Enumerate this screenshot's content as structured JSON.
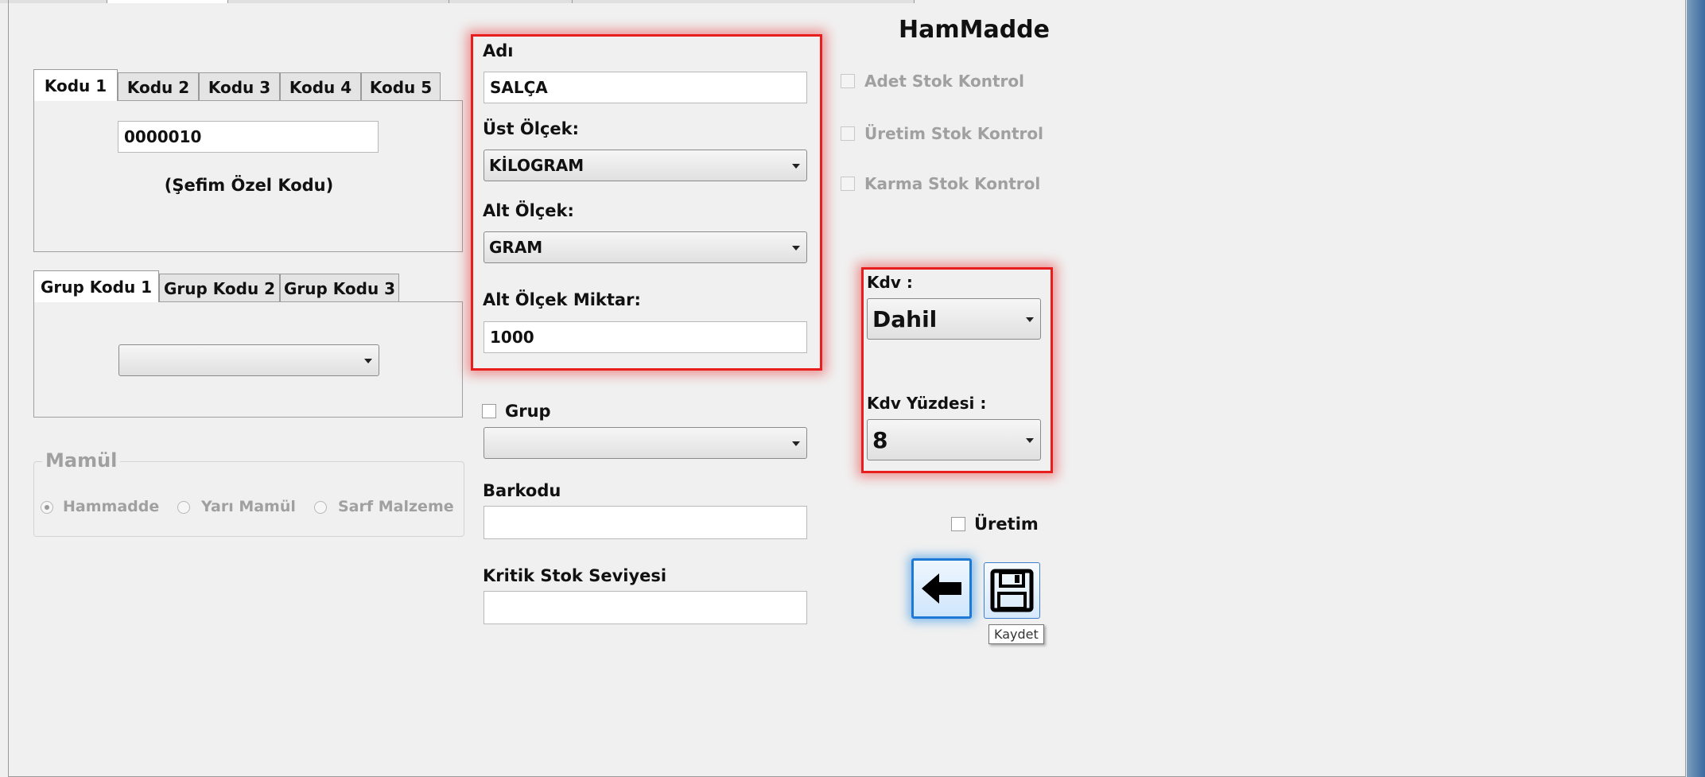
{
  "window": {
    "title": "HamMadde"
  },
  "code_tabs": {
    "tabs": [
      "Kodu 1",
      "Kodu 2",
      "Kodu 3",
      "Kodu 4",
      "Kodu 5"
    ],
    "value": "0000010",
    "caption": "(Şefim Özel Kodu)"
  },
  "group_tabs": {
    "tabs": [
      "Grup Kodu 1",
      "Grup Kodu 2",
      "Grup Kodu 3"
    ],
    "selected": ""
  },
  "mamul": {
    "title": "Mamül",
    "options": [
      "Hammadde",
      "Yarı Mamül",
      "Sarf Malzeme"
    ],
    "selected": "Hammadde"
  },
  "form": {
    "adi_label": "Adı",
    "adi_value": "SALÇA",
    "ust_olcek_label": "Üst Ölçek:",
    "ust_olcek_value": "KİLOGRAM",
    "alt_olcek_label": "Alt Ölçek:",
    "alt_olcek_value": "GRAM",
    "alt_olcek_miktar_label": "Alt Ölçek Miktar:",
    "alt_olcek_miktar_value": "1000",
    "grup_label": "Grup",
    "grup_value": "",
    "barkodu_label": "Barkodu",
    "barkodu_value": "",
    "kritik_stok_label": "Kritik Stok Seviyesi",
    "kritik_stok_value": ""
  },
  "checks": {
    "adet_stok": "Adet Stok Kontrol",
    "uretim_stok": "Üretim Stok Kontrol",
    "karma_stok": "Karma Stok Kontrol",
    "uretim": "Üretim"
  },
  "kdv": {
    "label": "Kdv :",
    "value": "Dahil",
    "yuzde_label": "Kdv Yüzdesi :",
    "yuzde_value": "8"
  },
  "actions": {
    "back_icon": "arrow-left-icon",
    "save_icon": "floppy-disk-icon",
    "save_tooltip": "Kaydet"
  },
  "colors": {
    "highlight": "#e81e1e",
    "focus": "#2b8fe6"
  }
}
